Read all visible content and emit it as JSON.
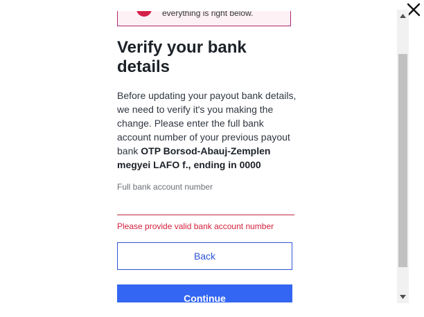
{
  "alert": {
    "text": "everything is right below.",
    "accent_color": "#d4214a",
    "border_color": "#b4236b",
    "background_color": "#fdf1f5"
  },
  "dialog": {
    "title": "Verify your bank details",
    "intro_text": "Before updating your payout bank details, we need to verify it's you making the change. Please enter the full bank account number of your previous payout bank ",
    "bank_name": "OTP Borsod-Abauj-Zemplen megyei LAFO f., ending in 0000"
  },
  "form": {
    "account_label": "Full bank account number",
    "account_value": "",
    "error_message": "Please provide valid bank account number",
    "error_color": "#d4213d"
  },
  "actions": {
    "back_label": "Back",
    "continue_label": "Continue",
    "primary_color": "#3366f2"
  },
  "icons": {
    "close": "close-icon",
    "scroll_up": "scroll-up-arrow-icon",
    "scroll_down": "scroll-down-arrow-icon"
  }
}
